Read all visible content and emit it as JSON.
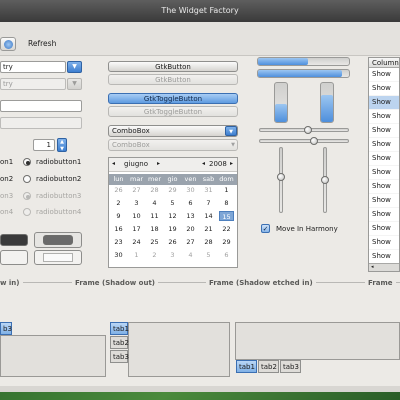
{
  "window": {
    "title": "The Widget Factory"
  },
  "toolbar": {
    "refresh_label": "Refresh"
  },
  "entries": {
    "combo_entry_value": "try",
    "combo_entry_disabled_value": "try"
  },
  "spin": {
    "value": "1"
  },
  "radios": [
    {
      "label": "radiobutton1",
      "checked": true,
      "disabled": false
    },
    {
      "label": "radiobutton2",
      "checked": false,
      "disabled": false
    },
    {
      "label": "radiobutton3",
      "checked": true,
      "disabled": true
    },
    {
      "label": "radiobutton4",
      "checked": false,
      "disabled": true
    }
  ],
  "left_radio_labels": [
    "on1",
    "on2",
    "on3",
    "on4"
  ],
  "buttons": {
    "gtkbutton": "GtkButton",
    "gtkbutton_disabled": "GtkButton",
    "toggle": "GtkToggleButton",
    "toggle_disabled": "GtkToggleButton"
  },
  "combobox": {
    "label": "ComboBox",
    "disabled_label": "ComboBox"
  },
  "calendar": {
    "month": "giugno",
    "year": "2008",
    "prev": "◂",
    "next": "▸",
    "weekdays": [
      "lun",
      "mar",
      "mer",
      "gio",
      "ven",
      "sab",
      "dom"
    ],
    "weeks": [
      [
        "26",
        "27",
        "28",
        "29",
        "30",
        "31",
        "1"
      ],
      [
        "2",
        "3",
        "4",
        "5",
        "6",
        "7",
        "8"
      ],
      [
        "9",
        "10",
        "11",
        "12",
        "13",
        "14",
        "15"
      ],
      [
        "16",
        "17",
        "18",
        "19",
        "20",
        "21",
        "22"
      ],
      [
        "23",
        "24",
        "25",
        "26",
        "27",
        "28",
        "29"
      ],
      [
        "30",
        "1",
        "2",
        "3",
        "4",
        "5",
        "6"
      ]
    ],
    "other_month_rows": [
      0,
      5
    ],
    "other_month_cols": {
      "0": [
        0,
        1,
        2,
        3,
        4,
        5
      ],
      "5": [
        1,
        2,
        3,
        4,
        5,
        6
      ]
    },
    "selected": "15"
  },
  "progress": {
    "h1": 0.55,
    "h2": 0.92,
    "v1": 0.45,
    "v2": 0.7
  },
  "scales": {
    "h1": 0.55,
    "h2": 0.62,
    "v1": 0.45,
    "v2": 0.5
  },
  "move_in_harmony": {
    "label": "Move In Harmony",
    "checked": true
  },
  "list": {
    "header": "Column",
    "items": [
      "Show",
      "Show",
      "Show",
      "Show",
      "Show",
      "Show",
      "Show",
      "Show",
      "Show",
      "Show",
      "Show",
      "Show",
      "Show",
      "Show",
      "Show"
    ],
    "selected_index": 2
  },
  "frames": {
    "shadow_in": "w in)",
    "shadow_out": "Frame (Shadow out)",
    "etched_in": "Frame (Shadow etched in)",
    "etched_out": "Frame"
  },
  "notebooks": {
    "nb1_tab": "b3",
    "nb2_tabs": [
      "tab1",
      "tab2",
      "tab3"
    ],
    "nb3_tabs": [
      "tab1",
      "tab2",
      "tab3"
    ]
  },
  "colors": {
    "accent": "#4e8fdc",
    "dark_swatch": "#3a3a3a",
    "mid_swatch": "#6a6a6a"
  }
}
